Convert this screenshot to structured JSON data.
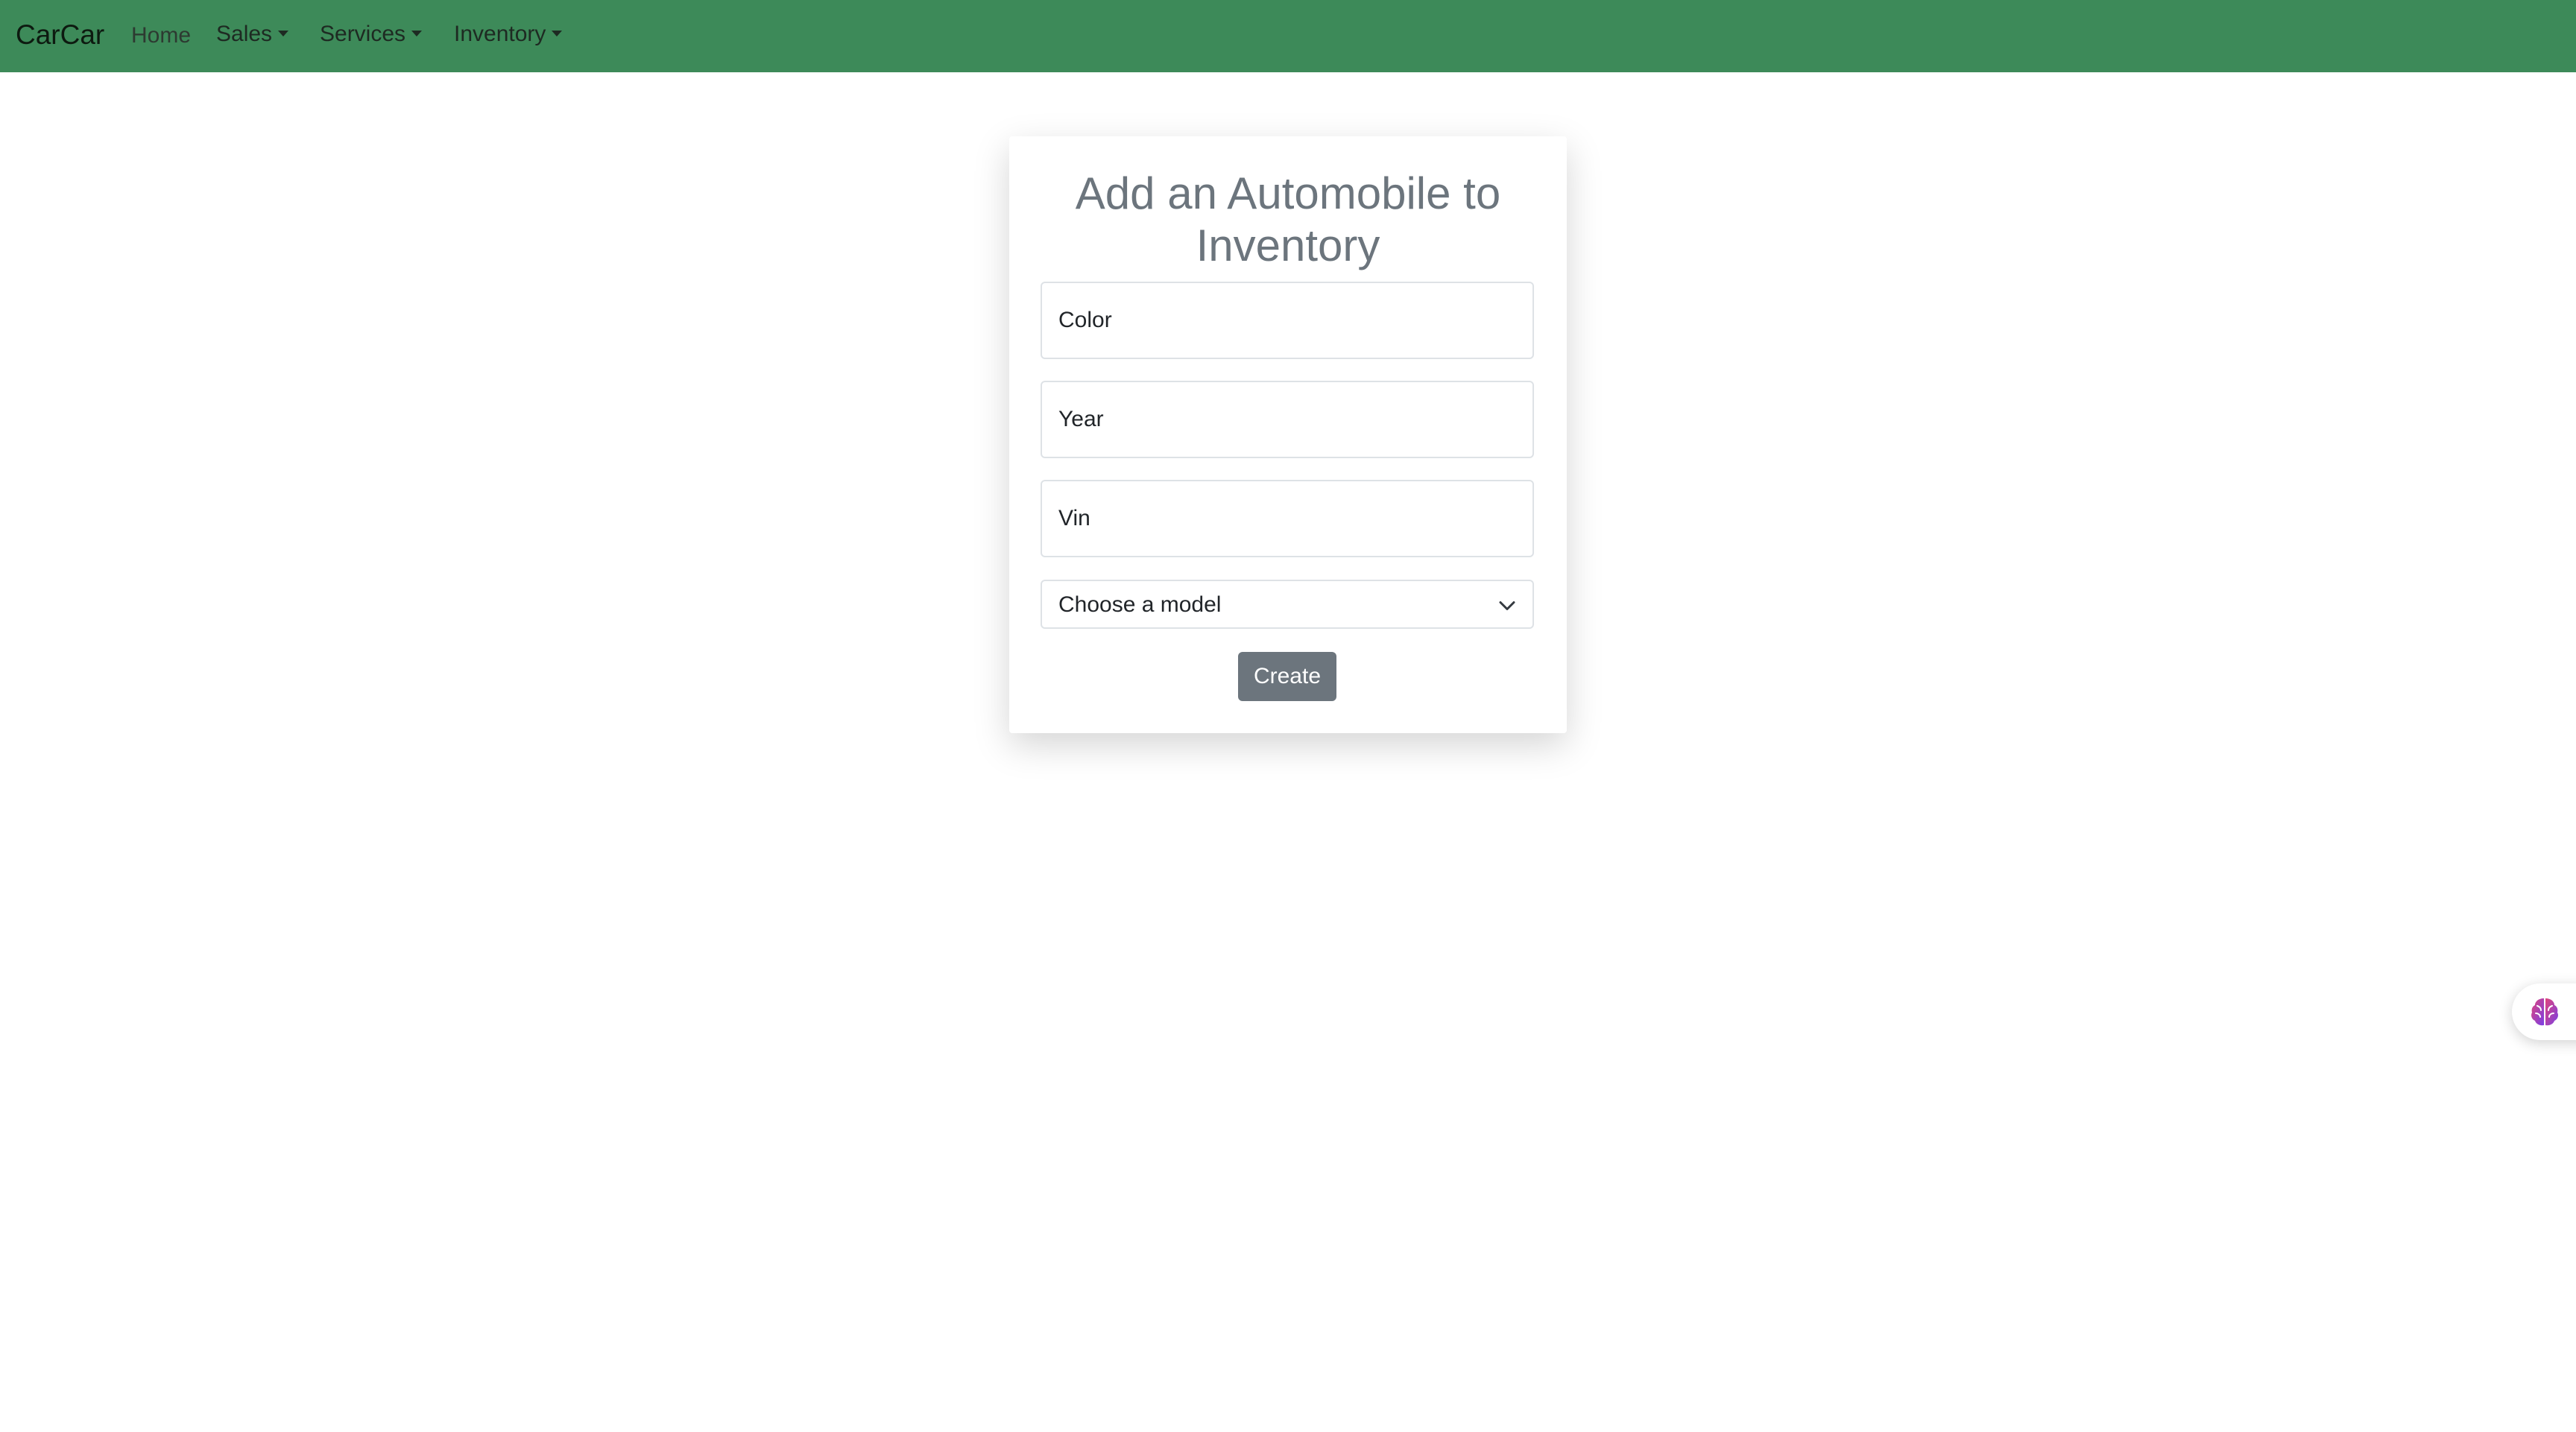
{
  "navbar": {
    "brand": "CarCar",
    "links": {
      "home": "Home",
      "sales": "Sales",
      "services": "Services",
      "inventory": "Inventory"
    },
    "background": "#3d8a59"
  },
  "form": {
    "title": "Add an Automobile to Inventory",
    "fields": {
      "color": "Color",
      "year": "Year",
      "vin": "Vin"
    },
    "model_select": "Choose a model",
    "submit_label": "Create"
  },
  "icons": {
    "dropdown": "chevron-down-icon",
    "widget": "brain-icon"
  }
}
